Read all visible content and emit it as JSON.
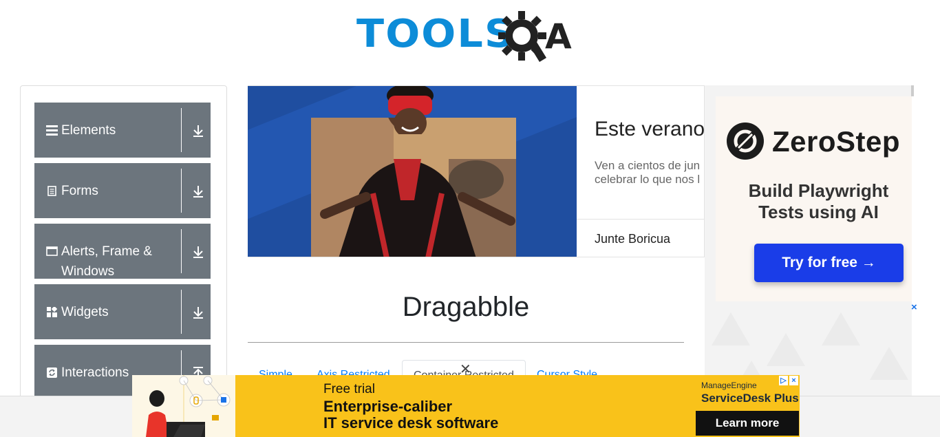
{
  "header": {
    "logo_tools": "TOOLS",
    "logo_qa": "A"
  },
  "sidebar": {
    "groups": [
      {
        "label": "Elements",
        "icon": "hamburger-icon",
        "arrow": "download-arrow-icon"
      },
      {
        "label": "Forms",
        "icon": "document-icon",
        "arrow": "download-arrow-icon"
      },
      {
        "label": "Alerts, Frame & Windows",
        "icon": "window-icon",
        "arrow": "download-arrow-icon"
      },
      {
        "label": "Widgets",
        "icon": "widgets-icon",
        "arrow": "download-arrow-icon"
      },
      {
        "label": "Interactions",
        "icon": "refresh-icon",
        "arrow": "upload-arrow-icon"
      }
    ]
  },
  "banner_ad": {
    "headline": "Este verano",
    "sub_line1": "Ven a cientos de jun",
    "sub_line2": "celebrar lo que nos l",
    "brand": "Junte Boricua"
  },
  "main": {
    "title": "Dragabble",
    "tabs": [
      {
        "label": "Simple",
        "active": false
      },
      {
        "label": "Axis Restricted",
        "active": false
      },
      {
        "label": "Container Restricted",
        "active": true
      },
      {
        "label": "Cursor Style",
        "active": false
      }
    ]
  },
  "side_ad": {
    "brand": "ZeroStep",
    "tagline_line1": "Build Playwright",
    "tagline_line2": "Tests using AI",
    "cta": "Try for free →",
    "close": "×"
  },
  "bottom_ad": {
    "trial": "Free trial",
    "line1": "Enterprise-caliber",
    "line2": "IT service desk software",
    "vendor": "ManageEngine",
    "product": "ServiceDesk Plus",
    "cta": "Learn more",
    "close": "×"
  },
  "colors": {
    "sidebar_bg": "#6c757d",
    "logo_blue": "#0d8cd8",
    "link": "#007bff",
    "ad_yellow": "#f9c21a",
    "cta_blue": "#1a3de8"
  }
}
